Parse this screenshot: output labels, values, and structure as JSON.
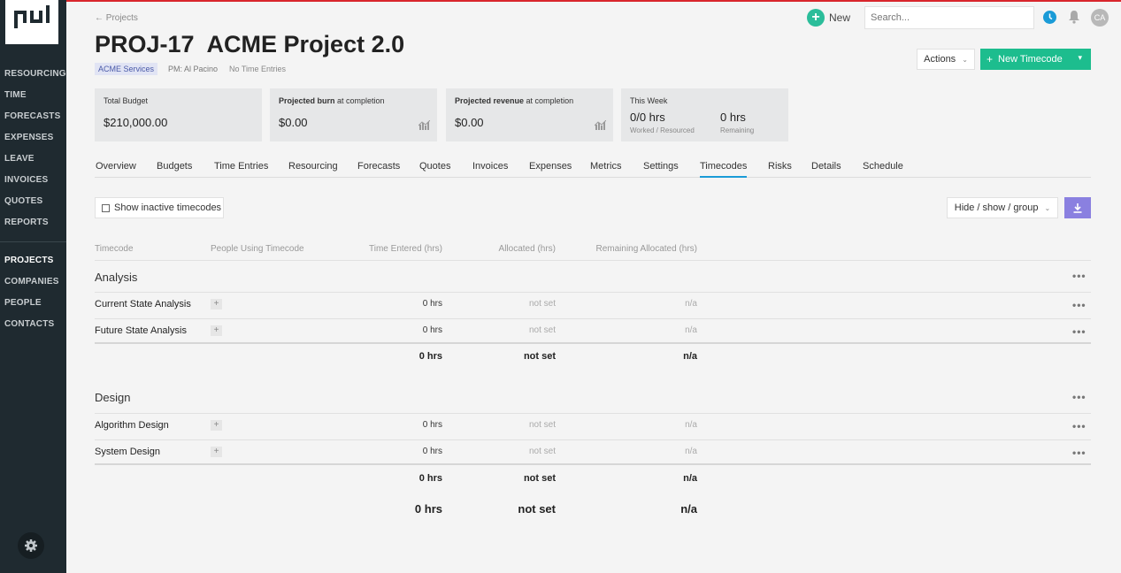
{
  "sidebar": {
    "nav_group_1": [
      "RESOURCING",
      "TIME",
      "FORECASTS",
      "EXPENSES",
      "LEAVE",
      "INVOICES",
      "QUOTES",
      "REPORTS"
    ],
    "nav_group_2": [
      "PROJECTS",
      "COMPANIES",
      "PEOPLE",
      "CONTACTS"
    ],
    "active": "PROJECTS"
  },
  "header": {
    "back_link": "← Projects",
    "new_label": "New",
    "search_placeholder": "Search...",
    "avatar_initials": "CA",
    "title": "PROJ-17  ACME Project 2.0",
    "company_tag": "ACME Services",
    "pm": "PM: Al Pacino",
    "entries": "No Time Entries",
    "actions_label": "Actions",
    "new_timecode_label": "New Timecode"
  },
  "cards": {
    "total_budget": {
      "label": "Total Budget",
      "value": "$210,000.00"
    },
    "projected_burn": {
      "label_bold": "Projected burn",
      "label_rest": " at completion",
      "value": "$0.00"
    },
    "projected_revenue": {
      "label_bold": "Projected revenue",
      "label_rest": " at completion",
      "value": "$0.00"
    },
    "this_week": {
      "label": "This Week",
      "worked_value": "0/0 hrs",
      "worked_sub": "Worked / Resourced",
      "remaining_value": "0 hrs",
      "remaining_sub": "Remaining"
    }
  },
  "tabs": [
    "Overview",
    "Budgets",
    "Time Entries",
    "Resourcing",
    "Forecasts",
    "Quotes",
    "Invoices",
    "Expenses",
    "Metrics",
    "Settings",
    "Timecodes",
    "Risks",
    "Details",
    "Schedule"
  ],
  "active_tab": "Timecodes",
  "controls": {
    "show_inactive_label": "Show inactive timecodes",
    "hide_show_label": "Hide / show / group"
  },
  "table": {
    "headers": [
      "Timecode",
      "People Using Timecode",
      "Time Entered (hrs)",
      "Allocated (hrs)",
      "Remaining Allocated (hrs)"
    ],
    "groups": [
      {
        "name": "Analysis",
        "rows": [
          {
            "name": "Current State Analysis",
            "time": "0 hrs",
            "allocated": "not set",
            "remaining": "n/a"
          },
          {
            "name": "Future State Analysis",
            "time": "0 hrs",
            "allocated": "not set",
            "remaining": "n/a"
          }
        ],
        "total": {
          "time": "0 hrs",
          "allocated": "not set",
          "remaining": "n/a"
        }
      },
      {
        "name": "Design",
        "rows": [
          {
            "name": "Algorithm Design",
            "time": "0 hrs",
            "allocated": "not set",
            "remaining": "n/a"
          },
          {
            "name": "System Design",
            "time": "0 hrs",
            "allocated": "not set",
            "remaining": "n/a"
          }
        ],
        "total": {
          "time": "0 hrs",
          "allocated": "not set",
          "remaining": "n/a"
        }
      }
    ],
    "grand_total": {
      "time": "0 hrs",
      "allocated": "not set",
      "remaining": "n/a"
    }
  },
  "colors": {
    "accent_green": "#1dbd8e",
    "accent_blue": "#1a9bd7",
    "download_purple": "#8a80e0",
    "sidebar": "#1f2a30",
    "brand_red": "#d9262c"
  }
}
